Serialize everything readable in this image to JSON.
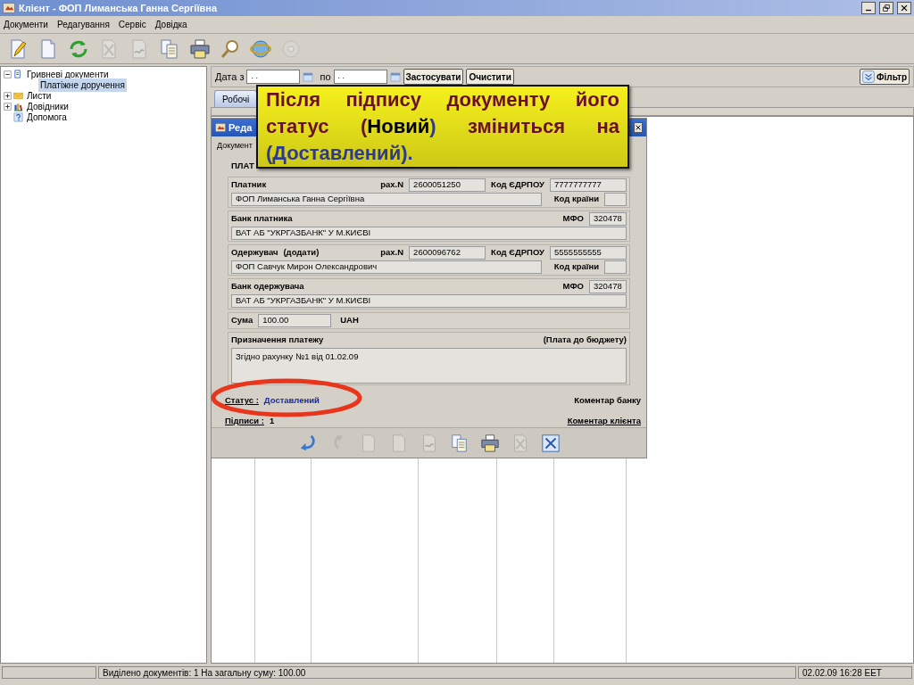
{
  "window": {
    "title": "Клієнт - ФОП Лиманська Ганна Сергіївна"
  },
  "menu": [
    "Документи",
    "Редагування",
    "Сервіс",
    "Довідка"
  ],
  "toolbar": [
    {
      "kind": "edit",
      "disabled": false
    },
    {
      "kind": "new",
      "disabled": false
    },
    {
      "kind": "refresh",
      "disabled": false
    },
    {
      "kind": "delete",
      "disabled": true
    },
    {
      "kind": "sign",
      "disabled": true
    },
    {
      "kind": "copy",
      "disabled": false
    },
    {
      "kind": "print",
      "disabled": false
    },
    {
      "kind": "search",
      "disabled": false
    },
    {
      "kind": "globe",
      "disabled": false
    },
    {
      "kind": "disc",
      "disabled": true
    }
  ],
  "tree": [
    {
      "label": "Гривневі документи",
      "kind": "docs",
      "expanded": true,
      "selected": false,
      "children": [
        {
          "label": "Платіжне доручення",
          "selected": true
        }
      ]
    },
    {
      "label": "Листи",
      "kind": "mail",
      "expanded": false,
      "selected": false
    },
    {
      "label": "Довідники",
      "kind": "books",
      "expanded": false,
      "selected": false
    },
    {
      "label": "Допомога",
      "kind": "help",
      "selected": false
    }
  ],
  "filter": {
    "date_from_label": "Дата з",
    "date_from": " .  .",
    "date_to_label": "по",
    "date_to": " .  .",
    "apply": "Застосувати",
    "clear": "Очистити",
    "filter": "Фільтр"
  },
  "tabs": [
    {
      "label": "Робочі",
      "selected": true
    }
  ],
  "dialog": {
    "title": "Реда",
    "doc_label": "Документ",
    "heading": "ПЛАТ",
    "parties": [
      {
        "kind": "party",
        "label": "Платник",
        "account_label": "рах.N",
        "account": "2600051250",
        "code_label": "Код ЄДРПОУ",
        "code": "7777777777",
        "name": "ФОП Лиманська Ганна Сергіївна",
        "country_label": "Код країни"
      },
      {
        "kind": "bank",
        "label": "Банк платника",
        "mfo_label": "МФО",
        "mfo": "320478",
        "name": "ВАТ АБ \"УКРГАЗБАНК\" У М.КИЄВІ"
      },
      {
        "kind": "party",
        "label": "Одержувач",
        "add_link": "(додати)",
        "account_label": "рах.N",
        "account": "2600096762",
        "code_label": "Код ЄДРПОУ",
        "code": "5555555555",
        "name": "ФОП Савчук Мирон Олександрович",
        "country_label": "Код країни"
      },
      {
        "kind": "bank",
        "label": "Банк одержувача",
        "mfo_label": "МФО",
        "mfo": "320478",
        "name": "ВАТ АБ \"УКРГАЗБАНК\" У М.КИЄВІ"
      }
    ],
    "amount": {
      "label": "Сума",
      "value": "100.00",
      "currency": "UAH"
    },
    "purpose": {
      "label": "Призначення платежу",
      "note": "(Плата до бюджету)",
      "text": "Згідно рахунку №1 від 01.02.09"
    },
    "status_label": "Статус :",
    "status": "Доставлений",
    "signatures_label": "Підписи :",
    "signatures": "1",
    "bank_comment": "Коментар банку",
    "client_comment": "Коментар клієнта",
    "toolbar": [
      {
        "kind": "return",
        "disabled": false
      },
      {
        "kind": "undo",
        "disabled": true
      },
      {
        "kind": "page",
        "disabled": true
      },
      {
        "kind": "page",
        "disabled": true
      },
      {
        "kind": "sign",
        "disabled": true
      },
      {
        "kind": "copy",
        "disabled": false
      },
      {
        "kind": "print",
        "disabled": false
      },
      {
        "kind": "delete",
        "disabled": true
      },
      {
        "kind": "close",
        "disabled": false
      }
    ]
  },
  "callout": {
    "segments": [
      {
        "text": "Після підпису документу його статус (",
        "color": "#6b0f2a"
      },
      {
        "text": "Новий",
        "color": "#000000"
      },
      {
        "text": ")",
        "color": "#2e3a8c"
      },
      {
        "text": " зміниться на ",
        "color": "#6b0f2a"
      },
      {
        "text": "(Доставлений).",
        "color": "#2e3a8c"
      }
    ]
  },
  "status_bar": {
    "selection": "Виділено документів: 1 На загальну суму: 100.00",
    "datetime": "02.02.09 16:28 EET"
  }
}
